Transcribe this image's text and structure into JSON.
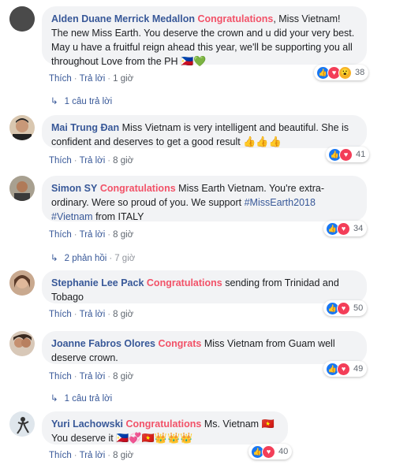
{
  "colors": {
    "author": "#385898",
    "highlight": "#f25268",
    "bubble": "#f2f3f5",
    "meta": "#606770"
  },
  "labels": {
    "like": "Thích",
    "reply": "Trả lời",
    "sep": "·"
  },
  "comments": [
    {
      "author": "Alden Duane Merrick Medallon",
      "highlight": "Congratulations",
      "text": ", Miss Vietnam! The new Miss Earth. You deserve the crown and u did your very best. May u have a fruitful reign ahead this year, we'll be supporting you all throughout Love from the PH",
      "emoji": "🇵🇭💚",
      "time": "1 giờ",
      "reactions": [
        "like",
        "love",
        "wow"
      ],
      "reaction_count": "38",
      "reply_summary": "1 câu trả lời",
      "reply_time": ""
    },
    {
      "author": "Mai Trung Đan",
      "highlight": "",
      "text": "Miss Vietnam is very intelligent and beautiful. She is confident and deserves to get a good result",
      "emoji": "👍👍👍",
      "time": "8 giờ",
      "reactions": [
        "like",
        "love"
      ],
      "reaction_count": "41"
    },
    {
      "author": "Simon SY",
      "highlight": "Congratulations",
      "text": "Miss Earth Vietnam. You're extra-ordinary. Were so proud of you. We support",
      "tags": "#MissEarth2018 #Vietnam",
      "text_after": "from ITALY",
      "time": "8 giờ",
      "reactions": [
        "like",
        "love"
      ],
      "reaction_count": "34",
      "reply_summary": "2 phản hồi",
      "reply_time": "7 giờ"
    },
    {
      "author": "Stephanie Lee Pack",
      "highlight": "Congratulations",
      "text": "sending from Trinidad and Tobago",
      "time": "8 giờ",
      "reactions": [
        "like",
        "love"
      ],
      "reaction_count": "50"
    },
    {
      "author": "Joanne Fabros Olores",
      "highlight": "Congrats",
      "text": "Miss Vietnam from Guam well deserve crown.",
      "time": "8 giờ",
      "reactions": [
        "like",
        "love"
      ],
      "reaction_count": "49",
      "reply_summary": "1 câu trả lời",
      "reply_time": ""
    },
    {
      "author": "Yuri Lachowski",
      "highlight": "Congratulations",
      "text": "Ms. Vietnam",
      "emoji": "🇻🇳",
      "text2": "You deserve it",
      "emoji2": "🇵🇭💞🇻🇳👑👑👑",
      "time": "8 giờ",
      "reactions": [
        "like",
        "love"
      ],
      "reaction_count": "40"
    }
  ]
}
